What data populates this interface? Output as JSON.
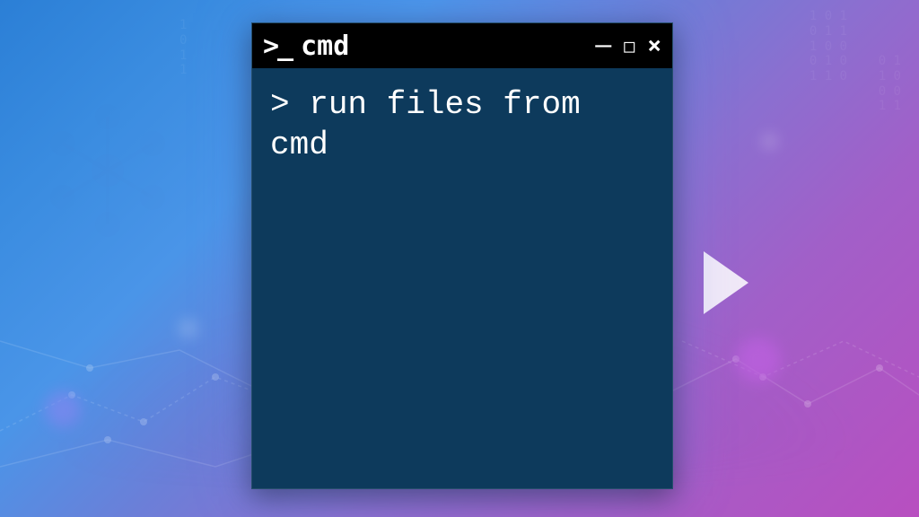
{
  "window": {
    "title": "cmd",
    "prompt_icon": ">_"
  },
  "controls": {
    "minimize": "–",
    "maximize": "□",
    "close": "×"
  },
  "terminal": {
    "prompt": ">",
    "command": "run files from cmd"
  },
  "colors": {
    "titlebar_bg": "#000000",
    "terminal_bg": "#0d3a5c",
    "text": "#ffffff"
  }
}
